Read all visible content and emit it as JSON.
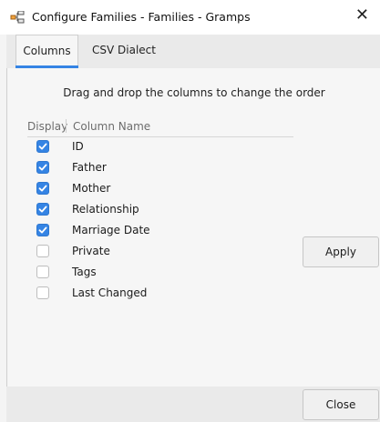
{
  "window": {
    "title": "Configure Families - Families - Gramps",
    "icons": {
      "app": "gramps-tree-icon",
      "close": "close-icon"
    },
    "close_glyph": "✕"
  },
  "tabs": [
    {
      "label": "Columns",
      "active": true
    },
    {
      "label": "CSV Dialect",
      "active": false
    }
  ],
  "columns_panel": {
    "hint": "Drag and drop the columns to change the order",
    "header": {
      "display": "Display",
      "column_name": "Column Name"
    },
    "rows": [
      {
        "label": "ID",
        "checked": true
      },
      {
        "label": "Father",
        "checked": true
      },
      {
        "label": "Mother",
        "checked": true
      },
      {
        "label": "Relationship",
        "checked": true
      },
      {
        "label": "Marriage Date",
        "checked": true
      },
      {
        "label": "Private",
        "checked": false
      },
      {
        "label": "Tags",
        "checked": false
      },
      {
        "label": "Last Changed",
        "checked": false
      }
    ]
  },
  "buttons": {
    "apply": "Apply",
    "close": "Close"
  },
  "colors": {
    "accent": "#3584e4"
  }
}
